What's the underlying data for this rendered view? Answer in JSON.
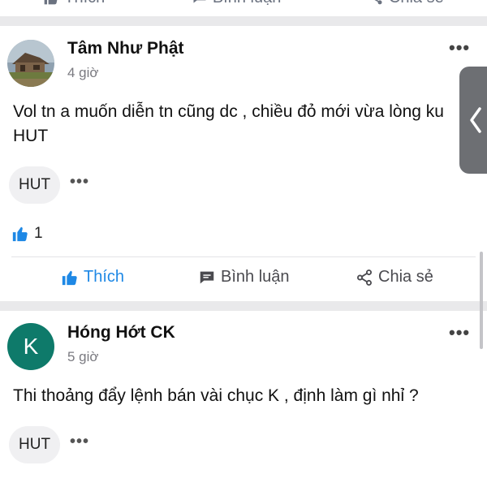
{
  "top_bar": {
    "like_label": "Thích",
    "comment_label": "Bình luận",
    "share_label": "Chia sẻ"
  },
  "posts": [
    {
      "author": "Tâm Như Phật",
      "time": "4 giờ",
      "avatar_type": "photo",
      "text": "Vol tn a muốn diễn tn cũng dc , chiều đỏ mới vừa lòng ku\nHUT",
      "tag": "HUT",
      "like_count": "1",
      "actions": {
        "like_label": "Thích",
        "comment_label": "Bình luận",
        "share_label": "Chia sẻ"
      }
    },
    {
      "author": "Hóng Hớt CK",
      "time": "5 giờ",
      "avatar_type": "letter",
      "avatar_letter": "K",
      "avatar_color": "#0e7a6a",
      "text": "Thi thoảng đẩy lệnh bán vài chục K , định làm gì nhỉ ?",
      "tag": "HUT"
    }
  ],
  "side_handle_icon": "chevron-left-icon",
  "colors": {
    "accent_blue": "#1e88e5",
    "divider": "#e9e9eb",
    "chip_bg": "#f0f0f2"
  }
}
